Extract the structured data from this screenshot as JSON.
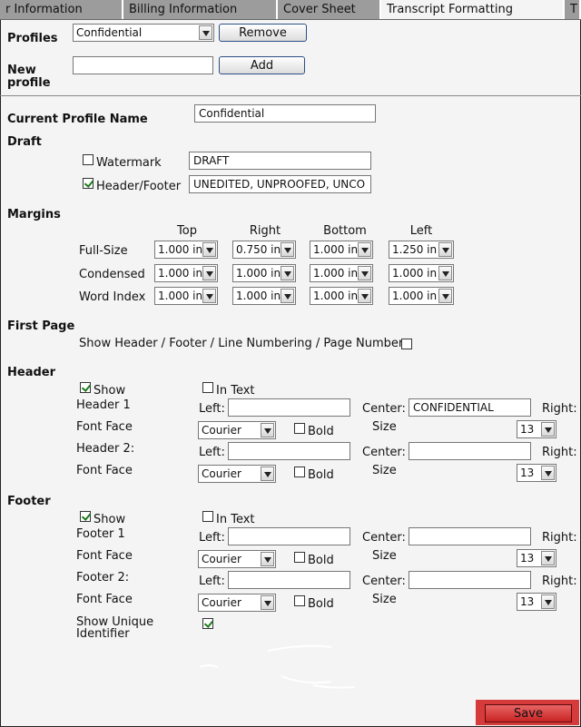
{
  "tabs": [
    {
      "label": "r Information"
    },
    {
      "label": "Billing Information"
    },
    {
      "label": "Cover Sheet"
    },
    {
      "label": "Transcript Formatting"
    },
    {
      "label": "T"
    }
  ],
  "profiles": {
    "label": "Profiles",
    "selected": "Confidential",
    "remove_label": "Remove",
    "new_label_line1": "New",
    "new_label_line2": "profile",
    "new_value": "",
    "add_label": "Add"
  },
  "current_profile": {
    "label": "Current Profile Name",
    "value": "Confidential"
  },
  "draft": {
    "label": "Draft",
    "watermark_label": "Watermark",
    "watermark_checked": false,
    "watermark_value": "DRAFT",
    "headerfooter_label": "Header/Footer",
    "headerfooter_checked": true,
    "headerfooter_value": "UNEDITED, UNPROOFED, UNCO"
  },
  "margins": {
    "label": "Margins",
    "columns": [
      "Top",
      "Right",
      "Bottom",
      "Left"
    ],
    "rows": [
      {
        "label": "Full-Size",
        "values": [
          "1.000 in",
          "0.750 in",
          "1.000 in",
          "1.250 in"
        ]
      },
      {
        "label": "Condensed",
        "values": [
          "1.000 in",
          "1.000 in",
          "1.000 in",
          "1.000 in"
        ]
      },
      {
        "label": "Word Index",
        "values": [
          "1.000 in",
          "1.000 in",
          "1.000 in",
          "1.000 in"
        ]
      }
    ]
  },
  "first_page": {
    "label": "First Page",
    "option_label": "Show Header / Footer / Line Numbering / Page Number",
    "checked": false
  },
  "header": {
    "label": "Header",
    "show_label": "Show",
    "show_checked": true,
    "intext_label": "In Text",
    "intext_checked": false,
    "lines": [
      {
        "name": "Header 1",
        "left": "",
        "center": "CONFIDENTIAL",
        "font": "Courier",
        "bold": false,
        "size": "13"
      },
      {
        "name": "Header 2:",
        "left": "",
        "center": "",
        "font": "Courier",
        "bold": false,
        "size": "13"
      }
    ]
  },
  "footer": {
    "label": "Footer",
    "show_label": "Show",
    "show_checked": true,
    "intext_label": "In Text",
    "intext_checked": false,
    "lines": [
      {
        "name": "Footer 1",
        "left": "",
        "center": "",
        "font": "Courier",
        "bold": false,
        "size": "13"
      },
      {
        "name": "Footer 2:",
        "left": "",
        "center": "",
        "font": "Courier",
        "bold": false,
        "size": "13"
      }
    ],
    "unique_id_label_line1": "Show Unique",
    "unique_id_label_line2": "Identifier",
    "unique_id_checked": true
  },
  "common": {
    "left_label": "Left:",
    "center_label": "Center:",
    "right_label": "Right:",
    "font_face_label": "Font Face",
    "bold_label": "Bold",
    "size_label": "Size"
  },
  "save_label": "Save"
}
